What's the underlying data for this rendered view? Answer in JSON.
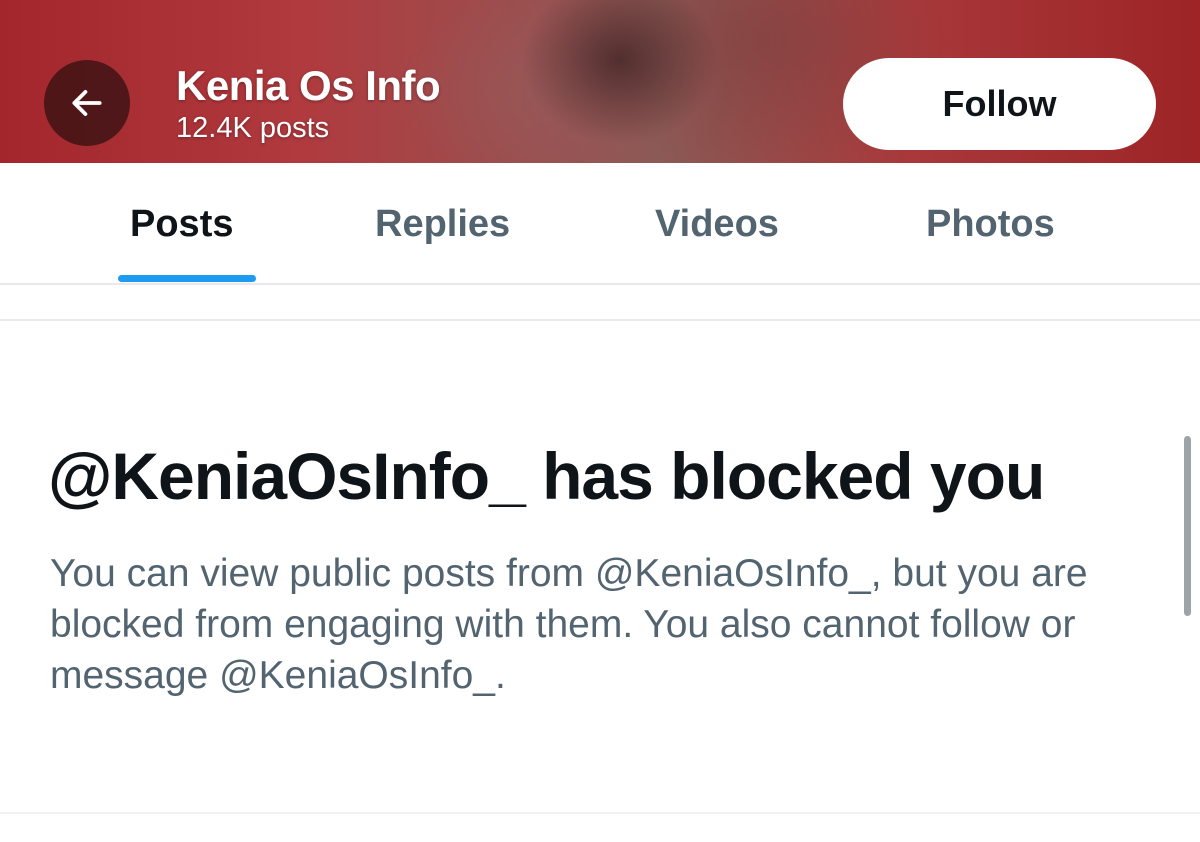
{
  "header": {
    "profile_name": "Kenia Os Info",
    "post_count": "12.4K posts",
    "follow_label": "Follow",
    "back_icon": "arrow-left-icon"
  },
  "tabs": [
    {
      "label": "Posts",
      "active": true
    },
    {
      "label": "Replies",
      "active": false
    },
    {
      "label": "Videos",
      "active": false
    },
    {
      "label": "Photos",
      "active": false
    }
  ],
  "notice": {
    "title": "@KeniaOsInfo_ has blocked you",
    "description": "You can view public posts from @KeniaOsInfo_, but you are blocked from engaging with them. You also cannot follow or message @KeniaOsInfo_."
  },
  "colors": {
    "banner": "#a3262c",
    "accent": "#1d9bf0",
    "primary_text": "#0f1419",
    "secondary_text": "#536471"
  }
}
